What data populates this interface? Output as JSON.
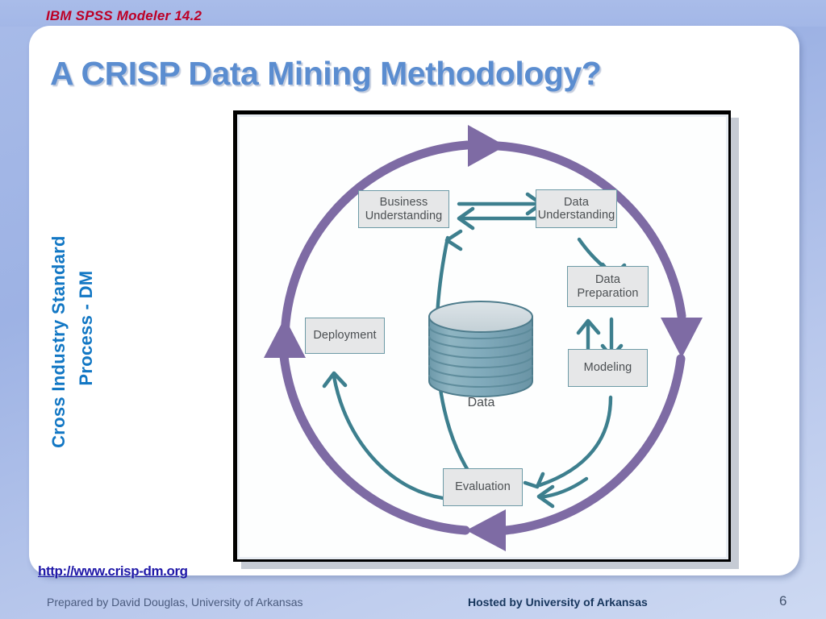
{
  "banner": {
    "product_title": "IBM SPSS Modeler 14.2"
  },
  "slide": {
    "title": "A CRISP Data Mining Methodology?",
    "side_caption_line1": "Cross Industry Standard",
    "side_caption_line2": "Process - DM",
    "url": "http://www.crisp-dm.org"
  },
  "figure": {
    "phases": [
      {
        "id": "business-understanding",
        "line1": "Business",
        "line2": "Understanding"
      },
      {
        "id": "data-understanding",
        "line1": "Data",
        "line2": "Understanding"
      },
      {
        "id": "data-preparation",
        "line1": "Data",
        "line2": "Preparation"
      },
      {
        "id": "modeling",
        "line1": "Modeling",
        "line2": ""
      },
      {
        "id": "deployment",
        "line1": "Deployment",
        "line2": ""
      },
      {
        "id": "evaluation",
        "line1": "Evaluation",
        "line2": ""
      }
    ],
    "data_store_label": "Data"
  },
  "footer": {
    "prepared_by": "Prepared by David Douglas, University of Arkansas",
    "hosted_by": "Hosted by University of Arkansas",
    "page_number": "6"
  },
  "colors": {
    "background_blue": "#a3b7e7",
    "banner_red": "#bd0026",
    "title_blue": "#5b8dd0",
    "caption_blue": "#1277c4",
    "link_blue": "#1f18a8",
    "outer_ring_purple": "#7e6ba4",
    "inner_arrow_teal": "#3d7f8e",
    "phase_box_fill": "#e6e7e8",
    "phase_box_border": "#6d9aa6",
    "cylinder_blue": "#7ea8b8"
  }
}
